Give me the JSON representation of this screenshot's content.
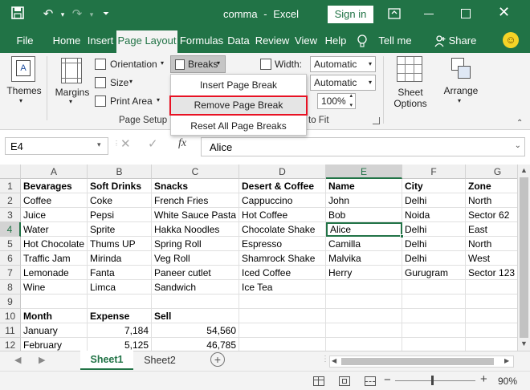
{
  "title": {
    "file": "comma",
    "sep": "-",
    "app": "Excel",
    "signin": "Sign in"
  },
  "tabs": [
    "File",
    "Home",
    "Insert",
    "Page Layout",
    "Formulas",
    "Data",
    "Review",
    "View",
    "Help",
    "Tell me",
    "Share"
  ],
  "ribbon": {
    "themes": "Themes",
    "margins": "Margins",
    "orientation": "Orientation",
    "size": "Size",
    "print_area": "Print Area",
    "breaks": "Breaks",
    "width_label": "Width:",
    "width_value": "Automatic",
    "height_value": "Automatic",
    "scale_value": "100%",
    "scale_to_fit": "to Fit",
    "sheet_options": "Sheet Options",
    "arrange": "Arrange",
    "page_setup": "Page Setup"
  },
  "breaks_menu": {
    "insert": "Insert Page Break",
    "remove": "Remove Page Break",
    "reset": "Reset All Page Breaks"
  },
  "formula_bar": {
    "name_box": "E4",
    "fx": "fx",
    "value": "Alice"
  },
  "columns": [
    "A",
    "B",
    "C",
    "D",
    "E",
    "F",
    "G"
  ],
  "rows": [
    "1",
    "2",
    "3",
    "4",
    "5",
    "6",
    "7",
    "8",
    "9",
    "10",
    "11",
    "12"
  ],
  "cells": {
    "r1": [
      "Bevarages",
      "Soft Drinks",
      "Snacks",
      "Desert & Coffee",
      "Name",
      "City",
      "Zone"
    ],
    "r2": [
      "Coffee",
      "Coke",
      "French Fries",
      "Cappuccino",
      "John",
      "Delhi",
      "North"
    ],
    "r3": [
      "Juice",
      "Pepsi",
      "White Sauce Pasta",
      "Hot Coffee",
      "Bob",
      "Noida",
      "Sector 62"
    ],
    "r4": [
      "Water",
      "Sprite",
      "Hakka Noodles",
      "Chocolate Shake",
      "Alice",
      "Delhi",
      "East"
    ],
    "r5": [
      "Hot Chocolate",
      "Thums UP",
      "Spring Roll",
      "Espresso",
      "Camilla",
      "Delhi",
      "North"
    ],
    "r6": [
      "Traffic Jam",
      "Mirinda",
      "Veg Roll",
      "Shamrock Shake",
      "Malvika",
      "Delhi",
      "West"
    ],
    "r7": [
      "Lemonade",
      "Fanta",
      "Paneer cutlet",
      "Iced Coffee",
      "Herry",
      "Gurugram",
      "Sector 123"
    ],
    "r8": [
      "Wine",
      "Limca",
      "Sandwich",
      "Ice Tea",
      "",
      "",
      ""
    ],
    "r9": [
      "",
      "",
      "",
      "",
      "",
      "",
      ""
    ],
    "r10": [
      "Month",
      "Expense",
      "Sell",
      "",
      "",
      "",
      ""
    ],
    "r11": [
      "January",
      "7,184",
      "54,560",
      "",
      "",
      "",
      ""
    ],
    "r12": [
      "February",
      "5,125",
      "46,785",
      "",
      "",
      "",
      ""
    ]
  },
  "sheets": [
    "Sheet1",
    "Sheet2"
  ],
  "status": {
    "zoom": "90%"
  },
  "colors": {
    "accent": "#217346",
    "highlight": "#e81123"
  }
}
